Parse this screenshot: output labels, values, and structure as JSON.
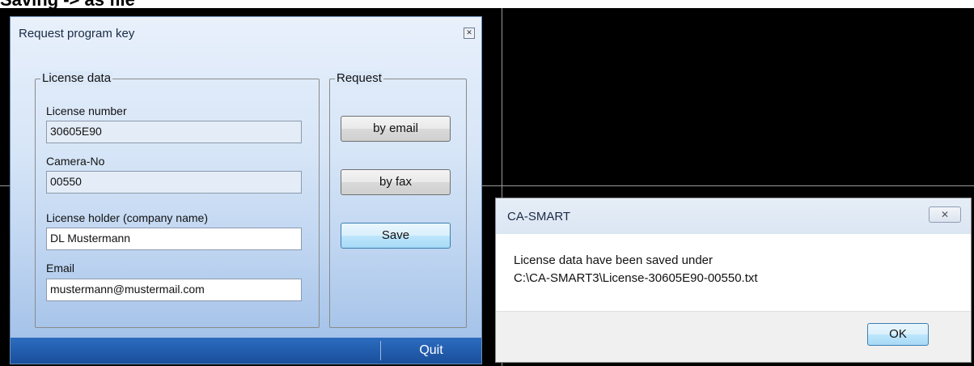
{
  "heading": "Saving -> as file",
  "dialog": {
    "title": "Request program key",
    "license_group": "License data",
    "request_group": "Request",
    "fields": {
      "license_number_label": "License number",
      "license_number_value": "30605E90",
      "camera_no_label": "Camera-No",
      "camera_no_value": "00550",
      "holder_label": "License holder (company name)",
      "holder_value": "DL Mustermann",
      "email_label": "Email",
      "email_value": "mustermann@mustermail.com"
    },
    "buttons": {
      "email": "by email",
      "fax": "by fax",
      "save": "Save",
      "quit": "Quit"
    }
  },
  "message_box": {
    "title": "CA-SMART",
    "line1": "License data have been saved under",
    "line2": "C:\\CA-SMART3\\License-30605E90-00550.txt",
    "ok": "OK"
  },
  "icons": {
    "close": "close-icon"
  }
}
